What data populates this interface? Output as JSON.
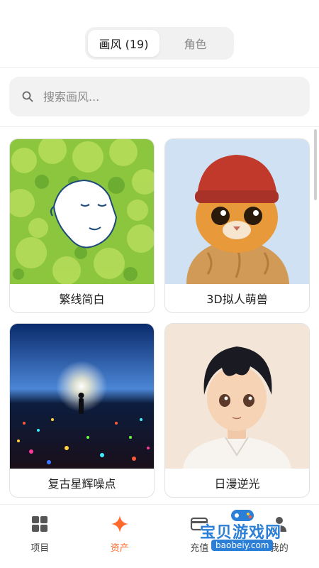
{
  "tabs": [
    {
      "label": "画风 (19)",
      "active": true
    },
    {
      "label": "角色",
      "active": false
    }
  ],
  "search": {
    "placeholder": "搜索画风..."
  },
  "styles": [
    {
      "label": "繁线简白",
      "thumb": "green-foliage-face"
    },
    {
      "label": "3D拟人萌兽",
      "thumb": "orange-cat-red-beanie"
    },
    {
      "label": "复古星辉噪点",
      "thumb": "starry-field-figure"
    },
    {
      "label": "日漫逆光",
      "thumb": "anime-boy-portrait"
    }
  ],
  "bottom_nav": [
    {
      "label": "项目",
      "icon": "grid-icon",
      "active": false
    },
    {
      "label": "资产",
      "icon": "sparkle-icon",
      "active": true
    },
    {
      "label": "充值",
      "icon": "card-icon",
      "active": false
    },
    {
      "label": "我的",
      "icon": "person-icon",
      "active": false
    }
  ],
  "watermark": {
    "title": "宝贝游戏网",
    "url": "baobeiy.com"
  },
  "colors": {
    "accent": "#ff6a2c",
    "watermark": "#2b7fd6"
  }
}
